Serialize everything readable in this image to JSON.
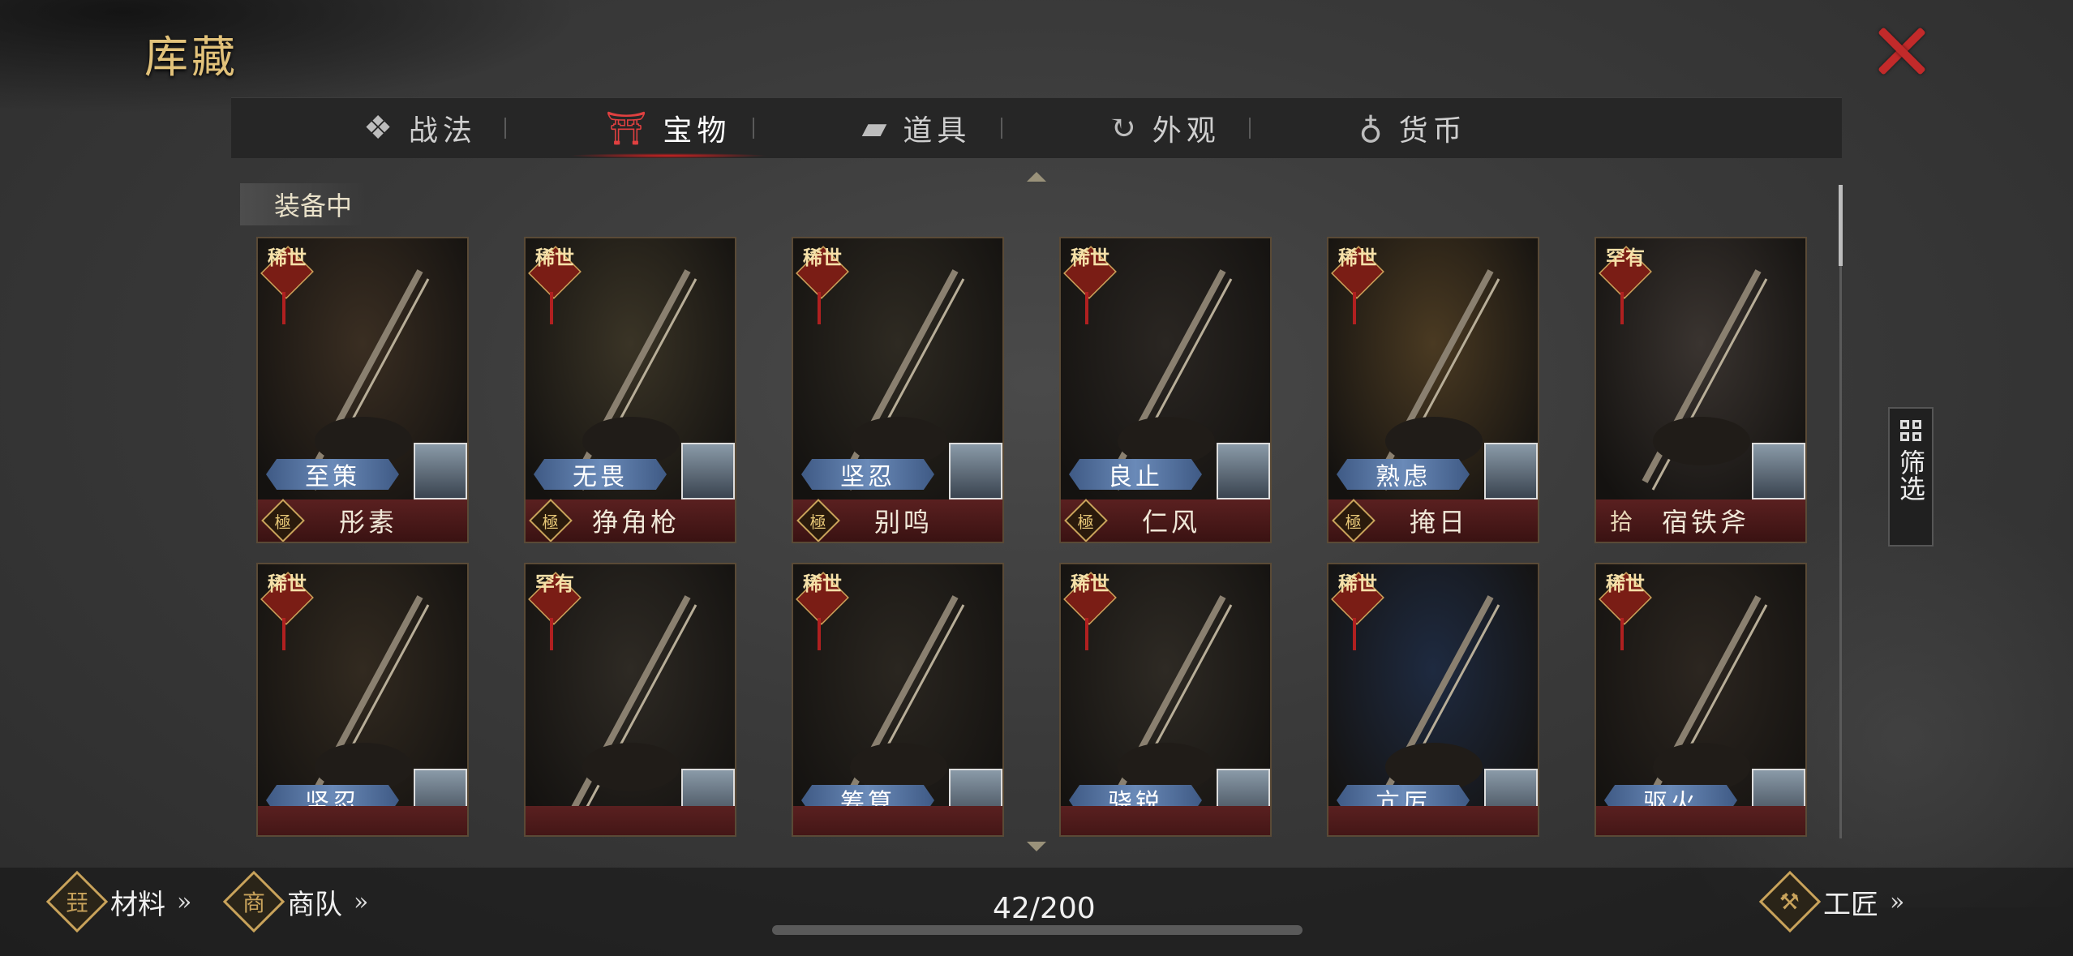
{
  "window": {
    "title": "库藏",
    "close_icon": "close-icon"
  },
  "tabs": [
    {
      "label": "战法",
      "icon": "scroll-bundle-icon",
      "active": false
    },
    {
      "label": "宝物",
      "icon": "weapon-rack-icon",
      "active": true
    },
    {
      "label": "道具",
      "icon": "chest-icon",
      "active": false
    },
    {
      "label": "外观",
      "icon": "swirl-icon",
      "active": false
    },
    {
      "label": "货币",
      "icon": "money-bag-icon",
      "active": false
    }
  ],
  "section": {
    "label": "装备中"
  },
  "cards": [
    {
      "rarity": "稀世",
      "skill": "至策",
      "grade": "極",
      "name": "彤素",
      "art_color": "#3a2e22"
    },
    {
      "rarity": "稀世",
      "skill": "无畏",
      "grade": "極",
      "name": "狰角枪",
      "art_color": "#3a3426"
    },
    {
      "rarity": "稀世",
      "skill": "坚忍",
      "grade": "極",
      "name": "别鸣",
      "art_color": "#2e2a22"
    },
    {
      "rarity": "稀世",
      "skill": "良止",
      "grade": "極",
      "name": "仁风",
      "art_color": "#2a2622"
    },
    {
      "rarity": "稀世",
      "skill": "熟虑",
      "grade": "極",
      "name": "掩日",
      "art_color": "#4a3a22"
    },
    {
      "rarity": "罕有",
      "skill": "",
      "grade": "拾",
      "name": "宿铁斧",
      "art_color": "#3a3430"
    },
    {
      "rarity": "稀世",
      "skill": "坚忍",
      "grade": "",
      "name": "",
      "art_color": "#322a20"
    },
    {
      "rarity": "罕有",
      "skill": "",
      "grade": "",
      "name": "",
      "art_color": "#2e2a24"
    },
    {
      "rarity": "稀世",
      "skill": "筹算",
      "grade": "",
      "name": "",
      "art_color": "#2a2620"
    },
    {
      "rarity": "稀世",
      "skill": "骁锐",
      "grade": "",
      "name": "",
      "art_color": "#2e2a24"
    },
    {
      "rarity": "稀世",
      "skill": "亢厉",
      "grade": "",
      "name": "",
      "art_color": "#1e2a40"
    },
    {
      "rarity": "稀世",
      "skill": "驱火",
      "grade": "",
      "name": "",
      "art_color": "#2c2620"
    }
  ],
  "filter": {
    "label": "筛选"
  },
  "footer": {
    "materials_label": "材料",
    "materials_icon_char": "㠭",
    "caravan_label": "商队",
    "caravan_icon_char": "商",
    "craftsman_label": "工匠",
    "craftsman_icon_char": "⚒",
    "chevrons": "»",
    "count": "42/200"
  }
}
